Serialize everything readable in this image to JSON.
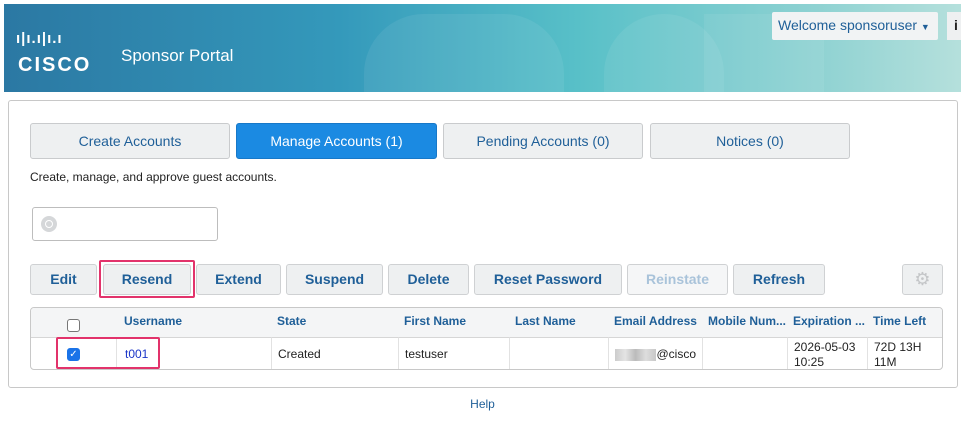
{
  "header": {
    "brand": "CISCO",
    "title": "Sponsor Portal",
    "welcome": "Welcome sponsoruser",
    "info_icon": "i"
  },
  "tabs": [
    {
      "label": "Create Accounts"
    },
    {
      "label": "Manage Accounts (1)",
      "active": true
    },
    {
      "label": "Pending Accounts (0)"
    },
    {
      "label": "Notices (0)"
    }
  ],
  "description": "Create, manage, and approve guest accounts.",
  "search": {
    "value": "",
    "placeholder": ""
  },
  "toolbar": {
    "edit": "Edit",
    "resend": "Resend",
    "extend": "Extend",
    "suspend": "Suspend",
    "delete": "Delete",
    "reset_password": "Reset Password",
    "reinstate": "Reinstate",
    "refresh": "Refresh"
  },
  "table": {
    "columns": [
      "Username",
      "State",
      "First Name",
      "Last Name",
      "Email Address",
      "Mobile Num...",
      "Expiration ...",
      "Time Left"
    ],
    "rows": [
      {
        "selected": true,
        "username": "t001",
        "state": "Created",
        "first_name": "testuser",
        "last_name": "",
        "email": "@cisco",
        "mobile": "",
        "expiration": "2026-05-03 10:25",
        "time_left": "72D 13H 11M"
      }
    ]
  },
  "footer": {
    "help": "Help"
  },
  "colors": {
    "accent": "#1b8ae2",
    "highlight": "#e2336b"
  }
}
